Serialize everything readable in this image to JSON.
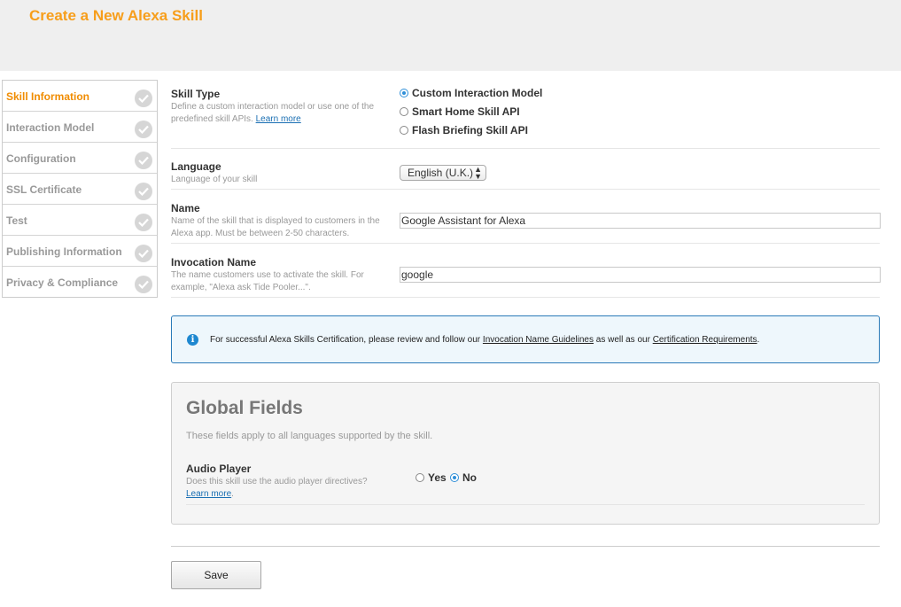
{
  "header": {
    "title": "Create a New Alexa Skill"
  },
  "sidebar": {
    "items": [
      {
        "label": "Skill Information",
        "active": true
      },
      {
        "label": "Interaction Model",
        "active": false
      },
      {
        "label": "Configuration",
        "active": false
      },
      {
        "label": "SSL Certificate",
        "active": false
      },
      {
        "label": "Test",
        "active": false
      },
      {
        "label": "Publishing Information",
        "active": false
      },
      {
        "label": "Privacy & Compliance",
        "active": false
      }
    ]
  },
  "skill_type": {
    "title": "Skill Type",
    "description": "Define a custom interaction model or use one of the predefined skill APIs.",
    "learn_more": "Learn more",
    "options": [
      {
        "label": "Custom Interaction Model",
        "selected": true
      },
      {
        "label": "Smart Home Skill API",
        "selected": false
      },
      {
        "label": "Flash Briefing Skill API",
        "selected": false
      }
    ]
  },
  "language": {
    "title": "Language",
    "description": "Language of your skill",
    "selected": "English (U.K.)"
  },
  "name": {
    "title": "Name",
    "description": "Name of the skill that is displayed to customers in the Alexa app. Must be between 2-50 characters.",
    "value": "Google Assistant for Alexa"
  },
  "invocation": {
    "title": "Invocation Name",
    "description": "The name customers use to activate the skill. For example, \"Alexa ask Tide Pooler...\".",
    "value": "google"
  },
  "info_box": {
    "text_before": "For successful Alexa Skills Certification, please review and follow our ",
    "link1": "Invocation Name Guidelines",
    "text_middle": " as well as our ",
    "link2": "Certification Requirements",
    "text_after": "."
  },
  "global_fields": {
    "title": "Global Fields",
    "subtitle": "These fields apply to all languages supported by the skill.",
    "audio_player": {
      "title": "Audio Player",
      "description": "Does this skill use the audio player directives?",
      "learn_more": "Learn more",
      "period": ".",
      "yes_label": "Yes",
      "no_label": "No",
      "selected": "No"
    }
  },
  "actions": {
    "save_label": "Save"
  },
  "colors": {
    "accent": "#f79e1b",
    "link": "#1a6fb3",
    "info_border": "#2a7ab8",
    "radio_selected": "#2f8fd8"
  }
}
